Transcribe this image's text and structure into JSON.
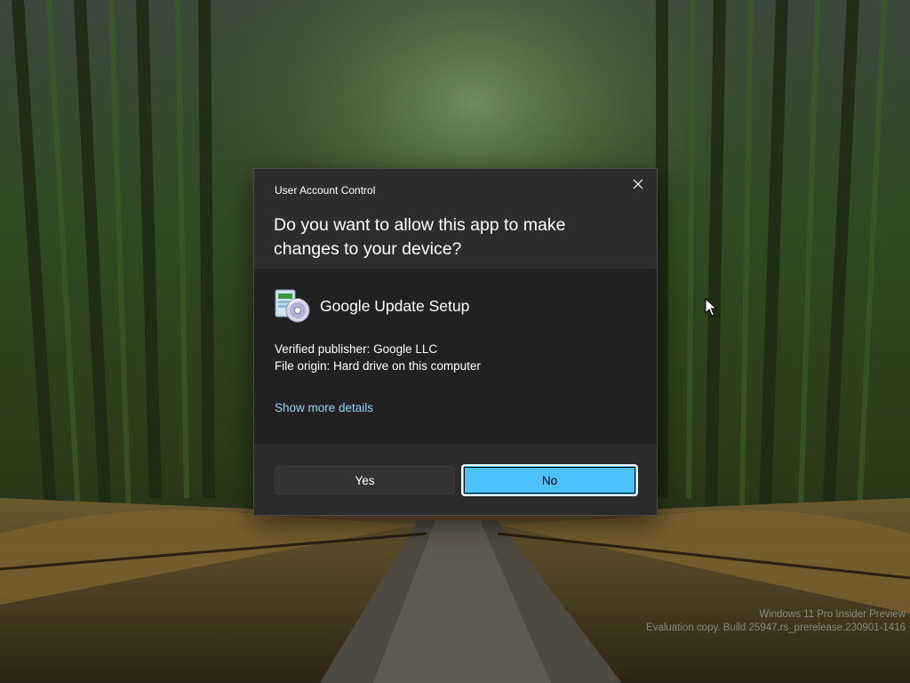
{
  "uac": {
    "title": "User Account Control",
    "question": "Do you want to allow this app to make changes to your device?",
    "app_name": "Google Update Setup",
    "publisher": "Verified publisher: Google LLC",
    "origin": "File origin: Hard drive on this computer",
    "details_link": "Show more details",
    "yes_label": "Yes",
    "no_label": "No",
    "close_icon": "close-icon",
    "app_icon": "installer-disc-icon"
  },
  "watermark": {
    "line1": "Windows 11 Pro Insider Preview",
    "line2": "Evaluation copy. Build 25947.rs_prerelease.230901-1416"
  },
  "colors": {
    "accent": "#4cc2ff",
    "link": "#8fd7ee",
    "dialog_bg": "#2b2b2b",
    "body_bg": "#212121"
  }
}
